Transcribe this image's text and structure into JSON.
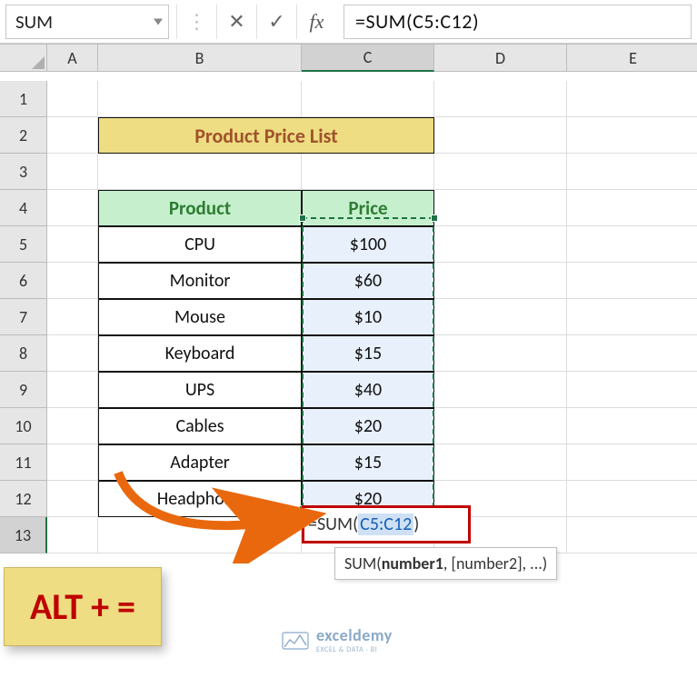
{
  "fbar": {
    "name_box": "SUM",
    "formula": "=SUM(C5:C12)"
  },
  "columns": [
    "A",
    "B",
    "C",
    "D",
    "E"
  ],
  "rows": [
    "1",
    "2",
    "3",
    "4",
    "5",
    "6",
    "7",
    "8",
    "9",
    "10",
    "11",
    "12",
    "13"
  ],
  "title": "Product Price List",
  "headers": {
    "product": "Product",
    "price": "Price"
  },
  "products": [
    {
      "name": "CPU",
      "price": "$100"
    },
    {
      "name": "Monitor",
      "price": "$60"
    },
    {
      "name": "Mouse",
      "price": "$10"
    },
    {
      "name": "Keyboard",
      "price": "$15"
    },
    {
      "name": "UPS",
      "price": "$40"
    },
    {
      "name": "Cables",
      "price": "$20"
    },
    {
      "name": "Adapter",
      "price": "$15"
    },
    {
      "name": "Headphone",
      "price": "$20"
    }
  ],
  "formula_cell": {
    "prefix": "=SUM(",
    "ref": "C5:C12",
    "suffix": ")"
  },
  "tooltip": {
    "func": "SUM",
    "arg1": "number1",
    "rest": ", [number2], ...)"
  },
  "callout": "ALT + =",
  "watermark": {
    "brand": "exceldemy",
    "sub": "EXCEL & DATA · BI"
  }
}
